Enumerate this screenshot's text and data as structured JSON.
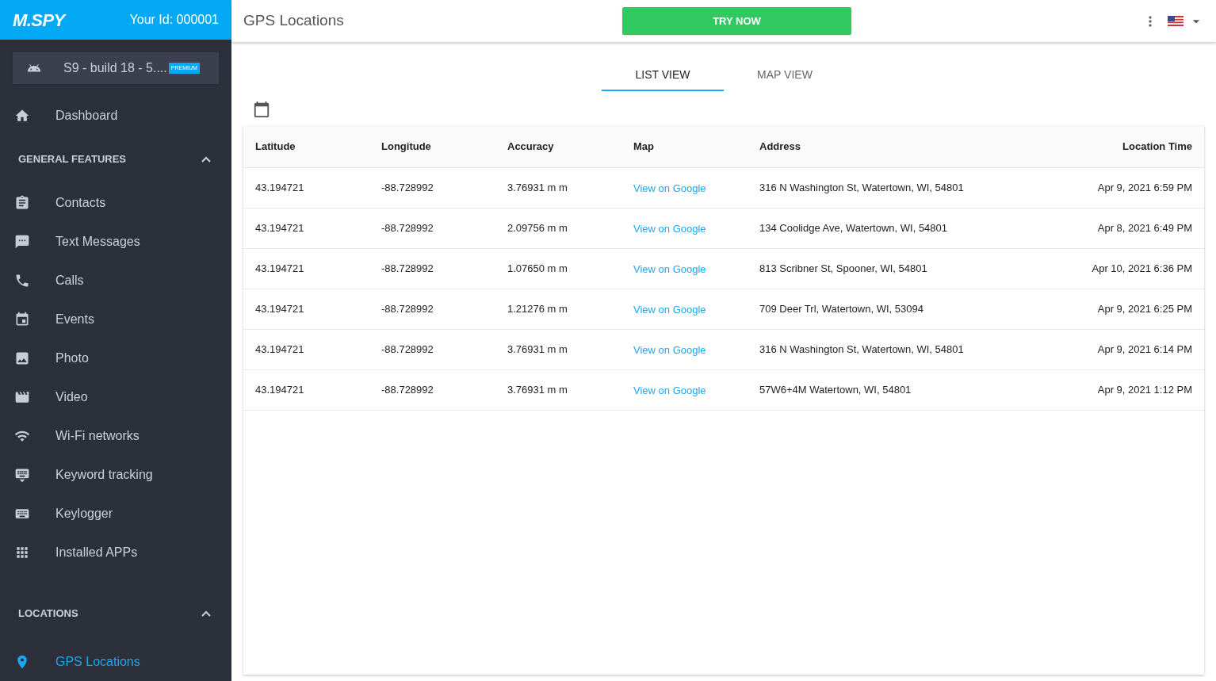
{
  "brand": {
    "logo": "M.SPY",
    "user_id": "Your Id: 000001"
  },
  "device": {
    "name": "S9 - build 18 - 5....",
    "badge": "PREMIUM"
  },
  "sidebar": {
    "top_items": [
      {
        "label": "Dashboard",
        "selected": false
      }
    ],
    "sections": [
      {
        "title": "GENERAL FEATURES",
        "expanded": true,
        "items": [
          {
            "label": "Contacts",
            "selected": false
          },
          {
            "label": "Text Messages",
            "selected": false
          },
          {
            "label": "Calls",
            "selected": false
          },
          {
            "label": "Events",
            "selected": false
          },
          {
            "label": "Photo",
            "selected": false
          },
          {
            "label": "Video",
            "selected": false
          },
          {
            "label": "Wi-Fi networks",
            "selected": false
          },
          {
            "label": "Keyword tracking",
            "selected": false
          },
          {
            "label": "Keylogger",
            "selected": false
          },
          {
            "label": "Installed APPs",
            "selected": false
          }
        ]
      },
      {
        "title": "LOCATIONS",
        "expanded": true,
        "items": [
          {
            "label": "GPS Locations",
            "selected": true
          }
        ]
      }
    ]
  },
  "header": {
    "title": "GPS Locations",
    "cta": "TRY NOW"
  },
  "tabs": [
    {
      "label": "LIST VIEW",
      "selected": true
    },
    {
      "label": "MAP VIEW",
      "selected": false
    }
  ],
  "table": {
    "columns": [
      "Latitude",
      "Longitude",
      "Accuracy",
      "Map",
      "Address",
      "Location Time"
    ],
    "rows": [
      [
        "43.194721",
        "-88.728992",
        "3.76931 m m",
        "View on Google",
        "316 N Washington St, Watertown, WI, 54801",
        "Apr 9, 2021 6:59 PM"
      ],
      [
        "43.194721",
        "-88.728992",
        "2.09756 m m",
        "View on Google",
        "134 Coolidge Ave, Watertown, WI, 54801",
        "Apr 8, 2021 6:49 PM"
      ],
      [
        "43.194721",
        "-88.728992",
        "1.07650 m m",
        "View on Google",
        "813 Scribner St, Spooner, WI, 54801",
        "Apr 10, 2021 6:36 PM"
      ],
      [
        "43.194721",
        "-88.728992",
        "1.21276 m m",
        "View on Google",
        "709 Deer Trl, Watertown, WI, 53094",
        "Apr 9, 2021 6:25 PM"
      ],
      [
        "43.194721",
        "-88.728992",
        "3.76931 m m",
        "View on Google",
        "316 N Washington St, Watertown, WI, 54801",
        "Apr 9, 2021 6:14 PM"
      ],
      [
        "43.194721",
        "-88.728992",
        "3.76931 m m",
        "View on Google",
        "57W6+4M Watertown, WI, 54801",
        "Apr 9, 2021 1:12 PM"
      ]
    ]
  }
}
